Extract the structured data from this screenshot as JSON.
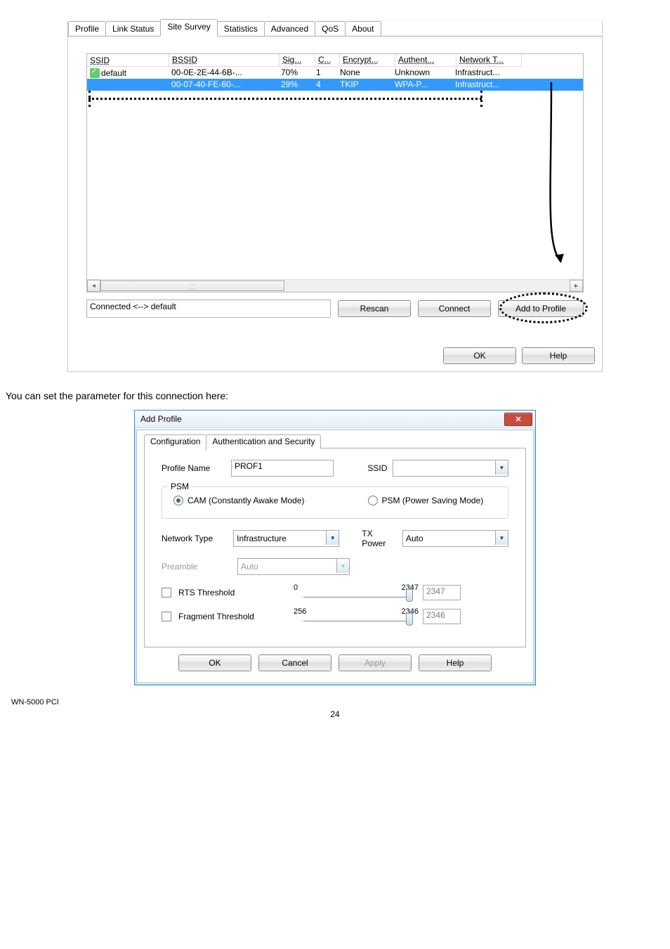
{
  "dialog1": {
    "tabs": [
      "Profile",
      "Link Status",
      "Site Survey",
      "Statistics",
      "Advanced",
      "QoS",
      "About"
    ],
    "active_tab": 2,
    "columns": [
      "SSID",
      "BSSID",
      "Sig...",
      "C...",
      "Encrypt...",
      "Authent...",
      "Network T..."
    ],
    "rows": [
      {
        "ssid": "default",
        "bssid": "00-0E-2E-44-6B-...",
        "sig": "70%",
        "ch": "1",
        "enc": "None",
        "auth": "Unknown",
        "net": "Infrastruct...",
        "selected": false,
        "connected": true
      },
      {
        "ssid": "",
        "bssid": "00-07-40-FE-60-...",
        "sig": "29%",
        "ch": "4",
        "enc": "TKIP",
        "auth": "WPA-P...",
        "net": "Infrastruct...",
        "selected": true,
        "connected": false
      }
    ],
    "status": "Connected <--> default",
    "buttons": {
      "rescan": "Rescan",
      "connect": "Connect",
      "add": "Add to Profile"
    },
    "bottom": {
      "ok": "OK",
      "help": "Help"
    }
  },
  "paragraph": "You can set the parameter for this connection here:",
  "dialog2": {
    "title": "Add Profile",
    "tabs": [
      "Configuration",
      "Authentication and Security"
    ],
    "active_tab": 0,
    "profile_name": {
      "label": "Profile Name",
      "value": "PROF1"
    },
    "ssid": {
      "label": "SSID",
      "value": ""
    },
    "psm": {
      "group": "PSM",
      "opt_cam": "CAM (Constantly Awake Mode)",
      "opt_psm": "PSM (Power Saving Mode)",
      "selected": "cam"
    },
    "network_type": {
      "label": "Network Type",
      "value": "Infrastructure"
    },
    "tx_power": {
      "label": "TX Power",
      "value": "Auto"
    },
    "preamble": {
      "label": "Preamble",
      "value": "Auto"
    },
    "rts": {
      "label": "RTS Threshold",
      "min": "0",
      "max": "2347",
      "value": "2347"
    },
    "frag": {
      "label": "Fragment Threshold",
      "min": "256",
      "max": "2346",
      "value": "2346"
    },
    "buttons": {
      "ok": "OK",
      "cancel": "Cancel",
      "apply": "Apply",
      "help": "Help"
    }
  },
  "footer": {
    "model": "WN-5000 PCI",
    "page": "24"
  }
}
